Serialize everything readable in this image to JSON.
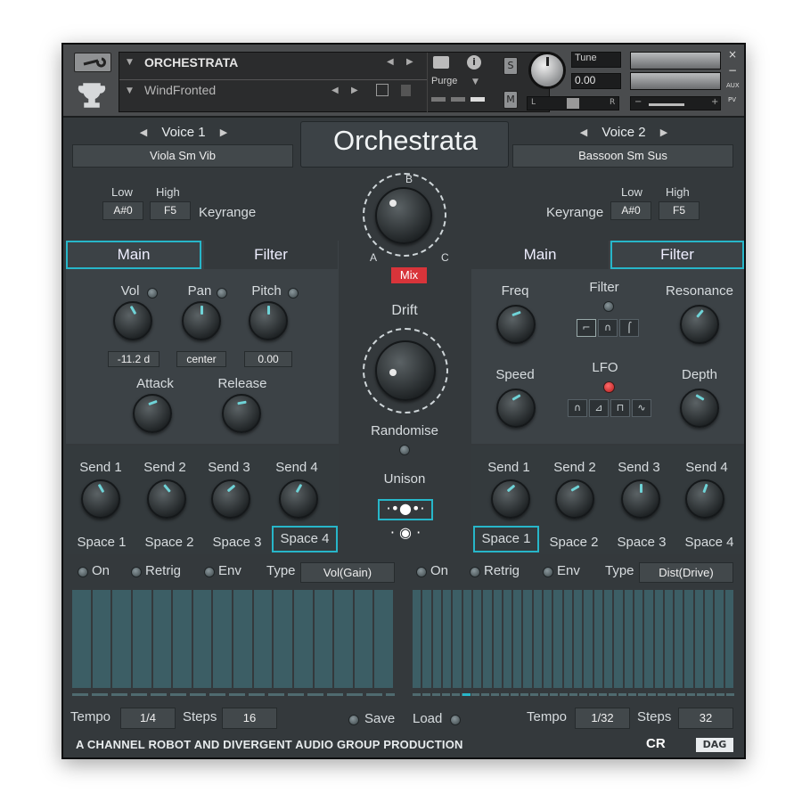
{
  "header": {
    "instrument_name": "ORCHESTRATA",
    "snapshot_name": "WindFronted",
    "purge_label": "Purge",
    "tune_label": "Tune",
    "tune_value": "0.00",
    "solo_label": "S",
    "mute_label": "M",
    "pan_left": "L",
    "pan_right": "R",
    "aux_label": "AUX",
    "pv_label": "PV",
    "close_label": "×",
    "minus_label": "−",
    "vol_minus": "−",
    "vol_plus": "+"
  },
  "title": "Orchestrata",
  "voice1": {
    "label": "Voice 1",
    "patch": "Viola Sm Vib",
    "low_label": "Low",
    "high_label": "High",
    "low": "A#0",
    "high": "F5",
    "keyrange_label": "Keyrange"
  },
  "voice2": {
    "label": "Voice 2",
    "patch": "Bassoon Sm Sus",
    "low_label": "Low",
    "high_label": "High",
    "low": "A#0",
    "high": "F5",
    "keyrange_label": "Keyrange"
  },
  "left_tabs": {
    "main": "Main",
    "filter": "Filter"
  },
  "right_tabs": {
    "main": "Main",
    "filter": "Filter"
  },
  "left_main": {
    "vol": "Vol",
    "pan": "Pan",
    "pitch": "Pitch",
    "vol_value": "-11.2 d",
    "pan_value": "center",
    "pitch_value": "0.00",
    "attack": "Attack",
    "release": "Release"
  },
  "right_filter": {
    "freq": "Freq",
    "filter": "Filter",
    "resonance": "Resonance",
    "speed": "Speed",
    "lfo": "LFO",
    "depth": "Depth"
  },
  "center": {
    "mix_a": "A",
    "mix_b": "B",
    "mix_c": "C",
    "mix_label": "Mix",
    "drift": "Drift",
    "randomise": "Randomise",
    "unison": "Unison"
  },
  "left_sends": {
    "labels": [
      "Send 1",
      "Send 2",
      "Send 3",
      "Send 4"
    ],
    "spaces": [
      "Space 1",
      "Space 2",
      "Space 3",
      "Space 4"
    ]
  },
  "right_sends": {
    "labels": [
      "Send 1",
      "Send 2",
      "Send 3",
      "Send 4"
    ],
    "spaces": [
      "Space 1",
      "Space 2",
      "Space 3",
      "Space 4"
    ]
  },
  "left_seq": {
    "on": "On",
    "retrig": "Retrig",
    "env": "Env",
    "type_label": "Type",
    "type_value": "Vol(Gain)",
    "tempo_label": "Tempo",
    "tempo": "1/4",
    "steps_label": "Steps",
    "steps": "16"
  },
  "right_seq": {
    "on": "On",
    "retrig": "Retrig",
    "env": "Env",
    "type_label": "Type",
    "type_value": "Dist(Drive)",
    "tempo_label": "Tempo",
    "tempo": "1/32",
    "steps_label": "Steps",
    "steps": "32"
  },
  "save_label": "Save",
  "load_label": "Load",
  "footer": {
    "credit": "A CHANNEL ROBOT AND DIVERGENT AUDIO GROUP PRODUCTION",
    "logo1": "CR",
    "logo2": "DAG"
  },
  "colors": {
    "accent": "#27b6c9",
    "mix_badge": "#d8343a",
    "lfo_led": "#d42c2c"
  }
}
